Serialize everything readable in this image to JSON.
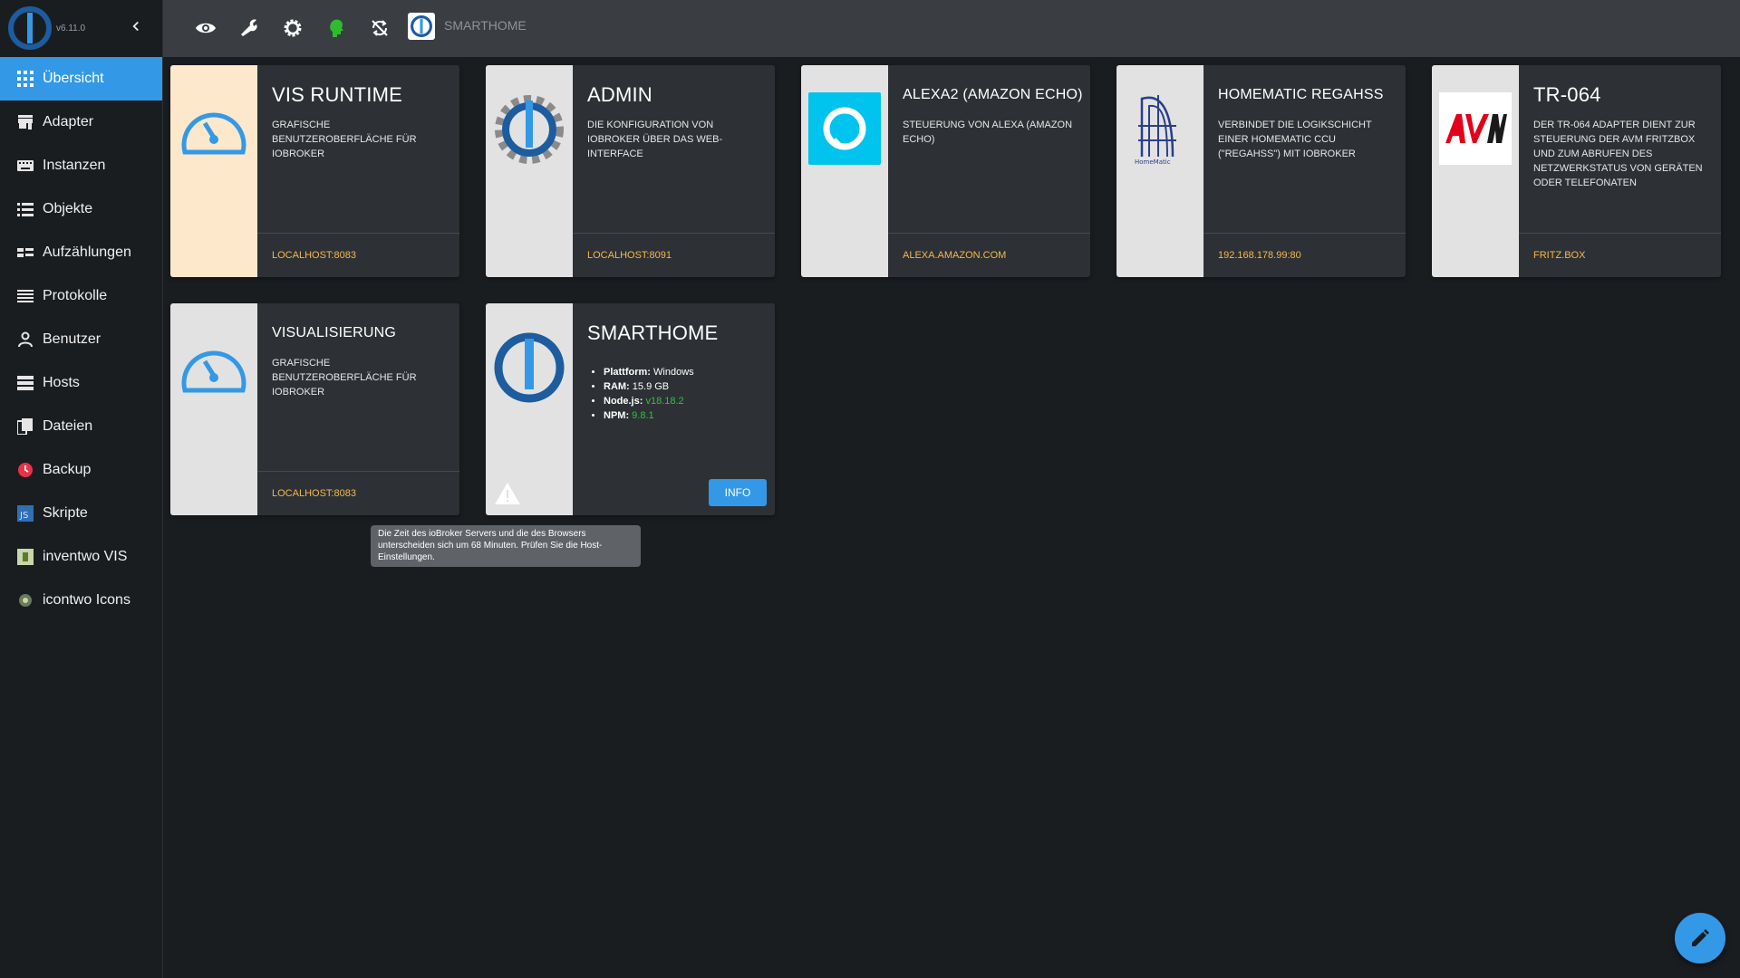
{
  "sidebar": {
    "version": "v6.11.0",
    "items": [
      {
        "label": "Übersicht"
      },
      {
        "label": "Adapter"
      },
      {
        "label": "Instanzen"
      },
      {
        "label": "Objekte"
      },
      {
        "label": "Aufzählungen"
      },
      {
        "label": "Protokolle"
      },
      {
        "label": "Benutzer"
      },
      {
        "label": "Hosts"
      },
      {
        "label": "Dateien"
      },
      {
        "label": "Backup"
      },
      {
        "label": "Skripte"
      },
      {
        "label": "inventwo VIS"
      },
      {
        "label": "icontwo Icons"
      }
    ]
  },
  "topbar": {
    "host_name": "SMARTHOME"
  },
  "cards": [
    {
      "title": "VIS RUNTIME",
      "desc": "GRAFISCHE BENUTZEROBERFLÄCHE FÜR IOBROKER",
      "link": "LOCALHOST:8083"
    },
    {
      "title": "ADMIN",
      "desc": "DIE KONFIGURATION VON IOBROKER ÜBER DAS WEB-INTERFACE",
      "link": "LOCALHOST:8091"
    },
    {
      "title": "ALEXA2 (AMAZON ECHO)",
      "desc": "STEUERUNG VON ALEXA (AMAZON ECHO)",
      "link": "ALEXA.AMAZON.COM"
    },
    {
      "title": "HOMEMATIC REGAHSS",
      "desc": "VERBINDET DIE LOGIKSCHICHT EINER HOMEMATIC CCU (\"REGAHSS\") MIT IOBROKER",
      "link": "192.168.178.99:80"
    },
    {
      "title": "TR-064",
      "desc": "DER TR-064 ADAPTER DIENT ZUR STEUERUNG DER AVM FRITZBOX UND ZUM ABRUFEN DES NETZWERKSTATUS VON GERÄTEN ODER TELEFONATEN",
      "link": "FRITZ.BOX"
    },
    {
      "title": "VISUALISIERUNG",
      "desc": "GRAFISCHE BENUTZEROBERFLÄCHE FÜR IOBROKER",
      "link": "LOCALHOST:8083"
    }
  ],
  "host_card": {
    "title": "SMARTHOME",
    "platform_label": "Plattform:",
    "platform": "Windows",
    "ram_label": "RAM:",
    "ram": "15.9 GB",
    "node_label": "Node.js:",
    "node": "v18.18.2",
    "npm_label": "NPM:",
    "npm": "9.8.1",
    "info_button": "INFO"
  },
  "tooltip": "Die Zeit des ioBroker Servers und die des Browsers unterscheiden sich um 68 Minuten. Prüfen Sie die Host-Einstellungen.",
  "colors": {
    "accent": "#3399e6",
    "link": "#f5b74e",
    "version_ok": "#33c040"
  }
}
